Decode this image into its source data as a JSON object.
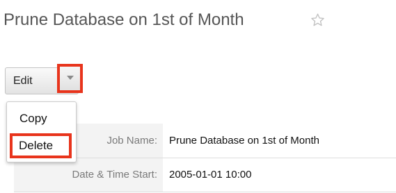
{
  "header": {
    "title": "Prune Database on 1st of Month",
    "favorite_icon": "star-outline-icon"
  },
  "actions": {
    "edit_label": "Edit",
    "dropdown_icon": "chevron-down-icon",
    "menu": [
      {
        "label": "Copy"
      },
      {
        "label": "Delete"
      }
    ],
    "highlight_color": "#e8341c"
  },
  "details": {
    "rows": [
      {
        "label": "Job Name:",
        "value": "Prune Database on 1st of Month"
      },
      {
        "label": "Date & Time Start:",
        "value": "2005-01-01 10:00"
      }
    ]
  }
}
